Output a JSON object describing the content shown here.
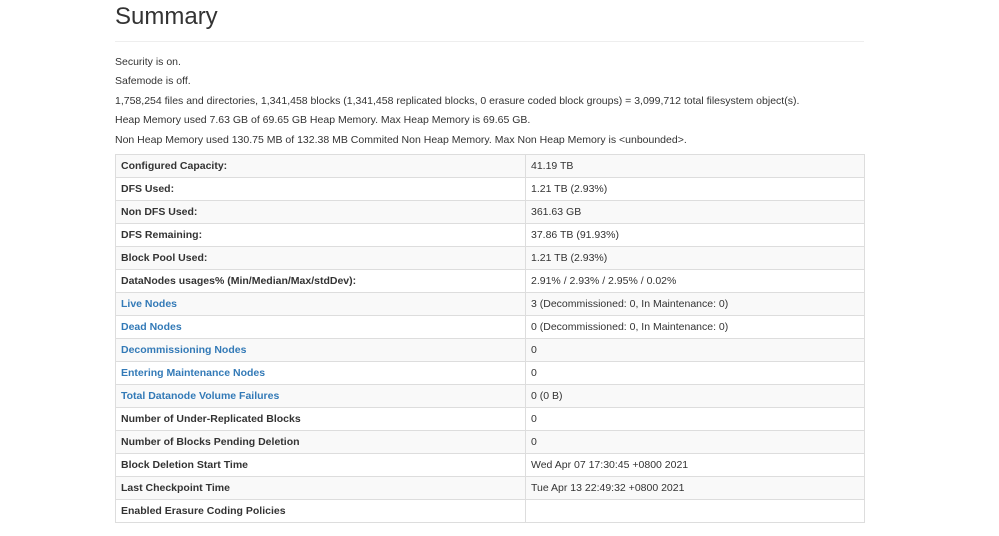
{
  "page": {
    "title": "Summary"
  },
  "info": [
    "Security is on.",
    "Safemode is off.",
    "1,758,254 files and directories, 1,341,458 blocks (1,341,458 replicated blocks, 0 erasure coded block groups) = 3,099,712 total filesystem object(s).",
    "Heap Memory used 7.63 GB of 69.65 GB Heap Memory. Max Heap Memory is 69.65 GB.",
    "Non Heap Memory used 130.75 MB of 132.38 MB Commited Non Heap Memory. Max Non Heap Memory is <unbounded>."
  ],
  "table": {
    "rows": [
      {
        "label": "Configured Capacity:",
        "value": "41.19 TB",
        "link": false
      },
      {
        "label": "DFS Used:",
        "value": "1.21 TB (2.93%)",
        "link": false
      },
      {
        "label": "Non DFS Used:",
        "value": "361.63 GB",
        "link": false
      },
      {
        "label": "DFS Remaining:",
        "value": "37.86 TB (91.93%)",
        "link": false
      },
      {
        "label": "Block Pool Used:",
        "value": "1.21 TB (2.93%)",
        "link": false
      },
      {
        "label": "DataNodes usages% (Min/Median/Max/stdDev):",
        "value": "2.91% / 2.93% / 2.95% / 0.02%",
        "link": false
      },
      {
        "label": "Live Nodes",
        "value": "3 (Decommissioned: 0, In Maintenance: 0)",
        "link": true
      },
      {
        "label": "Dead Nodes",
        "value": "0 (Decommissioned: 0, In Maintenance: 0)",
        "link": true
      },
      {
        "label": "Decommissioning Nodes",
        "value": "0",
        "link": true
      },
      {
        "label": "Entering Maintenance Nodes",
        "value": "0",
        "link": true
      },
      {
        "label": "Total Datanode Volume Failures",
        "value": "0 (0 B)",
        "link": true
      },
      {
        "label": "Number of Under-Replicated Blocks",
        "value": "0",
        "link": false
      },
      {
        "label": "Number of Blocks Pending Deletion",
        "value": "0",
        "link": false
      },
      {
        "label": "Block Deletion Start Time",
        "value": "Wed Apr 07 17:30:45 +0800 2021",
        "link": false
      },
      {
        "label": "Last Checkpoint Time",
        "value": "Tue Apr 13 22:49:32 +0800 2021",
        "link": false
      },
      {
        "label": "Enabled Erasure Coding Policies",
        "value": "",
        "link": false
      }
    ]
  },
  "colors": {
    "link": "#337ab7",
    "text": "#333333",
    "border": "#dddddd",
    "stripe": "#f9f9f9"
  }
}
